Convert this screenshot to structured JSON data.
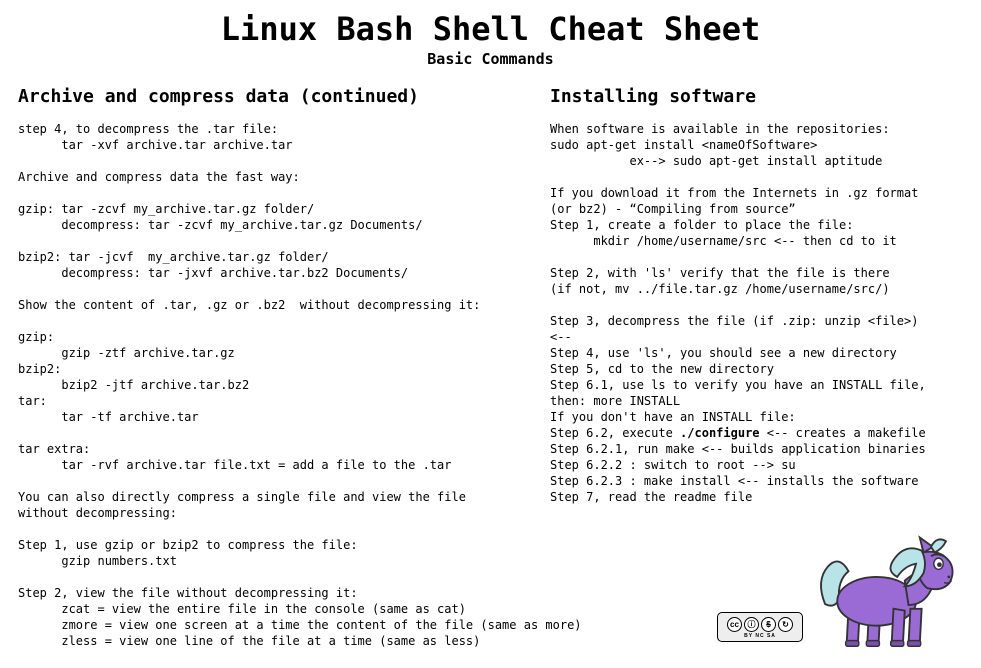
{
  "title": "Linux Bash Shell Cheat Sheet",
  "subtitle": "Basic Commands",
  "left": {
    "heading": "Archive and compress data (continued)",
    "body": "step 4, to decompress the .tar file:\n      tar -xvf archive.tar archive.tar\n\nArchive and compress data the fast way:\n\ngzip: tar -zcvf my_archive.tar.gz folder/\n      decompress: tar -zcvf my_archive.tar.gz Documents/\n\nbzip2: tar -jcvf  my_archive.tar.gz folder/\n      decompress: tar -jxvf archive.tar.bz2 Documents/\n\nShow the content of .tar, .gz or .bz2  without decompressing it:\n\ngzip:\n      gzip -ztf archive.tar.gz\nbzip2:\n      bzip2 -jtf archive.tar.bz2\ntar:\n      tar -tf archive.tar\n\ntar extra:\n      tar -rvf archive.tar file.txt = add a file to the .tar\n\nYou can also directly compress a single file and view the file\nwithout decompressing:\n\nStep 1, use gzip or bzip2 to compress the file:\n      gzip numbers.txt\n\nStep 2, view the file without decompressing it:\n      zcat = view the entire file in the console (same as cat)\n      zmore = view one screen at a time the content of the file (same as more)\n      zless = view one line of the file at a time (same as less)"
  },
  "right": {
    "heading": "Installing software",
    "body_part1": "When software is available in the repositories:\nsudo apt-get install <nameOfSoftware>\n           ex--> sudo apt-get install aptitude\n\nIf you download it from the Internets in .gz format\n(or bz2) - “Compiling from source”\nStep 1, create a folder to place the file:\n      mkdir /home/username/src <-- then cd to it\n\nStep 2, with 'ls' verify that the file is there\n(if not, mv ../file.tar.gz /home/username/src/)\n\nStep 3, decompress the file (if .zip: unzip <file>)\n<--\nStep 4, use 'ls', you should see a new directory\nStep 5, cd to the new directory\nStep 6.1, use ls to verify you have an INSTALL file,\nthen: more INSTALL\nIf you don't have an INSTALL file:\nStep 6.2, execute ",
    "bold_configure": "./configure",
    "body_part2": " <-- creates a ",
    "italic_makefile": "makefile",
    "body_part3": "\nStep 6.2.1, run make <-- builds application binaries\nStep 6.2.2 : switch to root --> su\nStep 6.2.3 : make install <-- installs the software\nStep 7, read the readme file"
  },
  "cc": {
    "cc": "cc",
    "by": "ⓘ",
    "nc": "$",
    "sa": "↻",
    "label": "BY  NC  SA"
  }
}
